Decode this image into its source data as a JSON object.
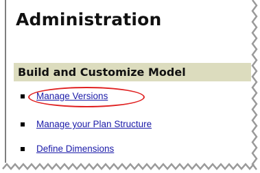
{
  "page": {
    "title": "Administration"
  },
  "section": {
    "title": "Build and Customize Model"
  },
  "menu": {
    "items": [
      {
        "label": "Manage Versions",
        "highlighted": true
      },
      {
        "label": "Manage your Plan Structure",
        "highlighted": false
      },
      {
        "label": "Define Dimensions",
        "highlighted": false
      }
    ]
  },
  "colors": {
    "link": "#1a1aa8",
    "section_background": "#dcdcbe",
    "highlight": "#e02020",
    "torn_edge_shadow": "#9a9a9a"
  },
  "icons": {
    "list_bullet": "square-bullet"
  }
}
